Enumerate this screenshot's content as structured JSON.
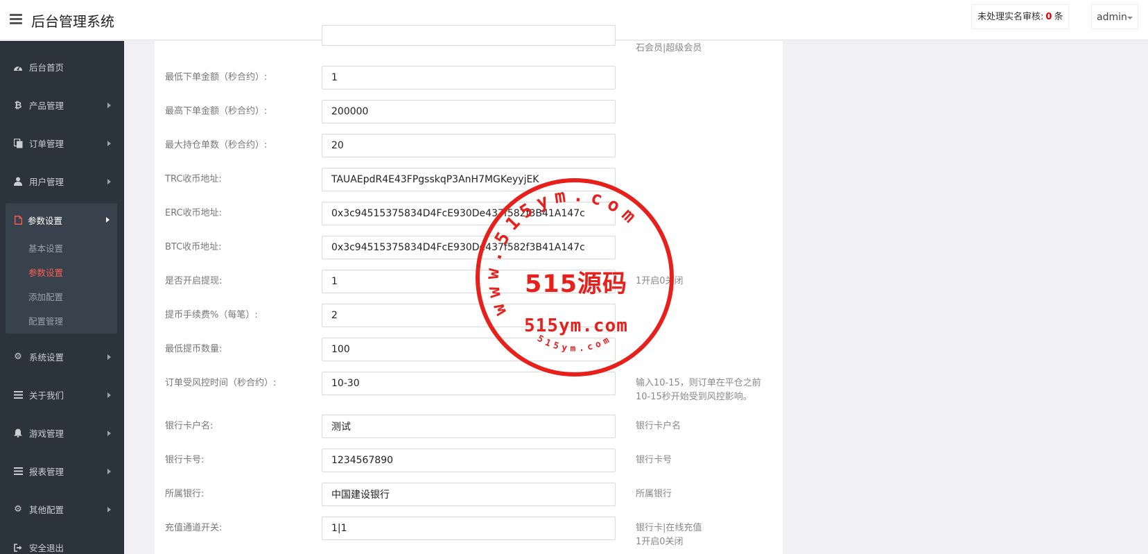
{
  "header": {
    "title": "后台管理系统",
    "pending_label": "未处理实名审核:",
    "pending_count": "0",
    "pending_unit": "条",
    "user": "admin"
  },
  "sidebar": {
    "items_top": [
      {
        "label": "后台首页",
        "icon": "dashboard-icon",
        "has_children": false
      },
      {
        "label": "产品管理",
        "icon": "bitcoin-icon",
        "has_children": true
      },
      {
        "label": "订单管理",
        "icon": "copy-icon",
        "has_children": true
      },
      {
        "label": "用户管理",
        "icon": "user-icon",
        "has_children": true
      }
    ],
    "active_group": {
      "label": "参数设置",
      "icon": "file-icon",
      "children": [
        {
          "label": "基本设置",
          "active": false
        },
        {
          "label": "参数设置",
          "active": true
        },
        {
          "label": "添加配置",
          "active": false
        },
        {
          "label": "配置管理",
          "active": false
        }
      ]
    },
    "items_bottom": [
      {
        "label": "系统设置",
        "icon": "gears-icon",
        "has_children": true
      },
      {
        "label": "关于我们",
        "icon": "list-icon",
        "has_children": true
      },
      {
        "label": "游戏管理",
        "icon": "bell-icon",
        "has_children": true
      },
      {
        "label": "报表管理",
        "icon": "list-icon",
        "has_children": true
      },
      {
        "label": "其他配置",
        "icon": "gear-icon",
        "has_children": true
      },
      {
        "label": "安全退出",
        "icon": "signout-icon",
        "has_children": false
      }
    ]
  },
  "form": {
    "top_help": "石会员|超级会员",
    "rows": [
      {
        "label": "最低下单金额（秒合约）:",
        "value": "1",
        "help": ""
      },
      {
        "label": "最高下单金额（秒合约）:",
        "value": "200000",
        "help": ""
      },
      {
        "label": "最大持仓单数（秒合约）:",
        "value": "20",
        "help": ""
      },
      {
        "label": "TRC收币地址:",
        "value": "TAUAEpdR4E43FPgsskqP3AnH7MGKeyyjEK",
        "help": ""
      },
      {
        "label": "ERC收币地址:",
        "value": "0x3c94515375834D4FcE930De437f582f3B41A147c",
        "help": ""
      },
      {
        "label": "BTC收币地址:",
        "value": "0x3c94515375834D4FcE930De437f582f3B41A147c",
        "help": ""
      },
      {
        "label": "是否开启提现:",
        "value": "1",
        "help": "1开启0关闭"
      },
      {
        "label": "提币手续费%（每笔）:",
        "value": "2",
        "help": ""
      },
      {
        "label": "最低提币数量:",
        "value": "100",
        "help": ""
      },
      {
        "label": "订单受风控时间（秒合约）:",
        "value": "10-30",
        "help": "输入10-15，则订单在平仓之前\n10-15秒开始受到风控影响。"
      },
      {
        "label": "银行卡户名:",
        "value": "测试",
        "help": "银行卡户名"
      },
      {
        "label": "银行卡号:",
        "value": "1234567890",
        "help": "银行卡号"
      },
      {
        "label": "所属银行:",
        "value": "中国建设银行",
        "help": "所属银行"
      },
      {
        "label": "充值通道开关:",
        "value": "1|1",
        "help": "银行卡|在线充值\n1开启0关闭"
      }
    ]
  },
  "watermark": {
    "main": "515源码",
    "url": "515ym.com",
    "ring_text": "www.515ym.com",
    "small_text": "515ym.com",
    "color": "#e8201c"
  }
}
